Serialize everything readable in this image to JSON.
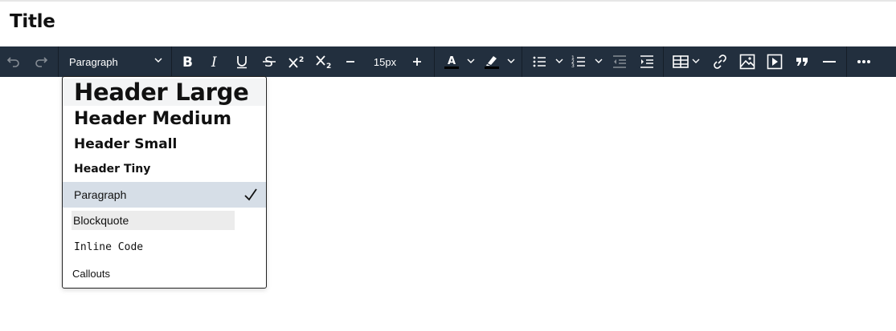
{
  "document": {
    "title": "Title"
  },
  "toolbar": {
    "block_format": "Paragraph",
    "font_size": "15px",
    "icons": [
      "undo-icon",
      "redo-icon",
      "bold-icon",
      "italic-icon",
      "underline-icon",
      "strikethrough-icon",
      "superscript-icon",
      "subscript-icon",
      "decrease-font-icon",
      "increase-font-icon",
      "text-color-icon",
      "highlight-icon",
      "bullet-list-icon",
      "numbered-list-icon",
      "outdent-icon",
      "indent-icon",
      "table-icon",
      "link-icon",
      "image-icon",
      "media-icon",
      "quote-icon",
      "horizontal-rule-icon",
      "more-icon"
    ],
    "colors": {
      "background": "#222f3e",
      "text_color_bar": "#000000",
      "highlight_bar": "#000000"
    }
  },
  "dropdown": {
    "items": [
      {
        "label": "Header Large"
      },
      {
        "label": "Header Medium"
      },
      {
        "label": "Header Small"
      },
      {
        "label": "Header Tiny"
      },
      {
        "label": "Paragraph",
        "selected": true
      },
      {
        "label": "Blockquote"
      },
      {
        "label": "Inline Code"
      },
      {
        "label": "Callouts"
      }
    ],
    "colors": {
      "selected_bg": "#d6dee7",
      "hover_bg": "#f3f4f5"
    }
  }
}
